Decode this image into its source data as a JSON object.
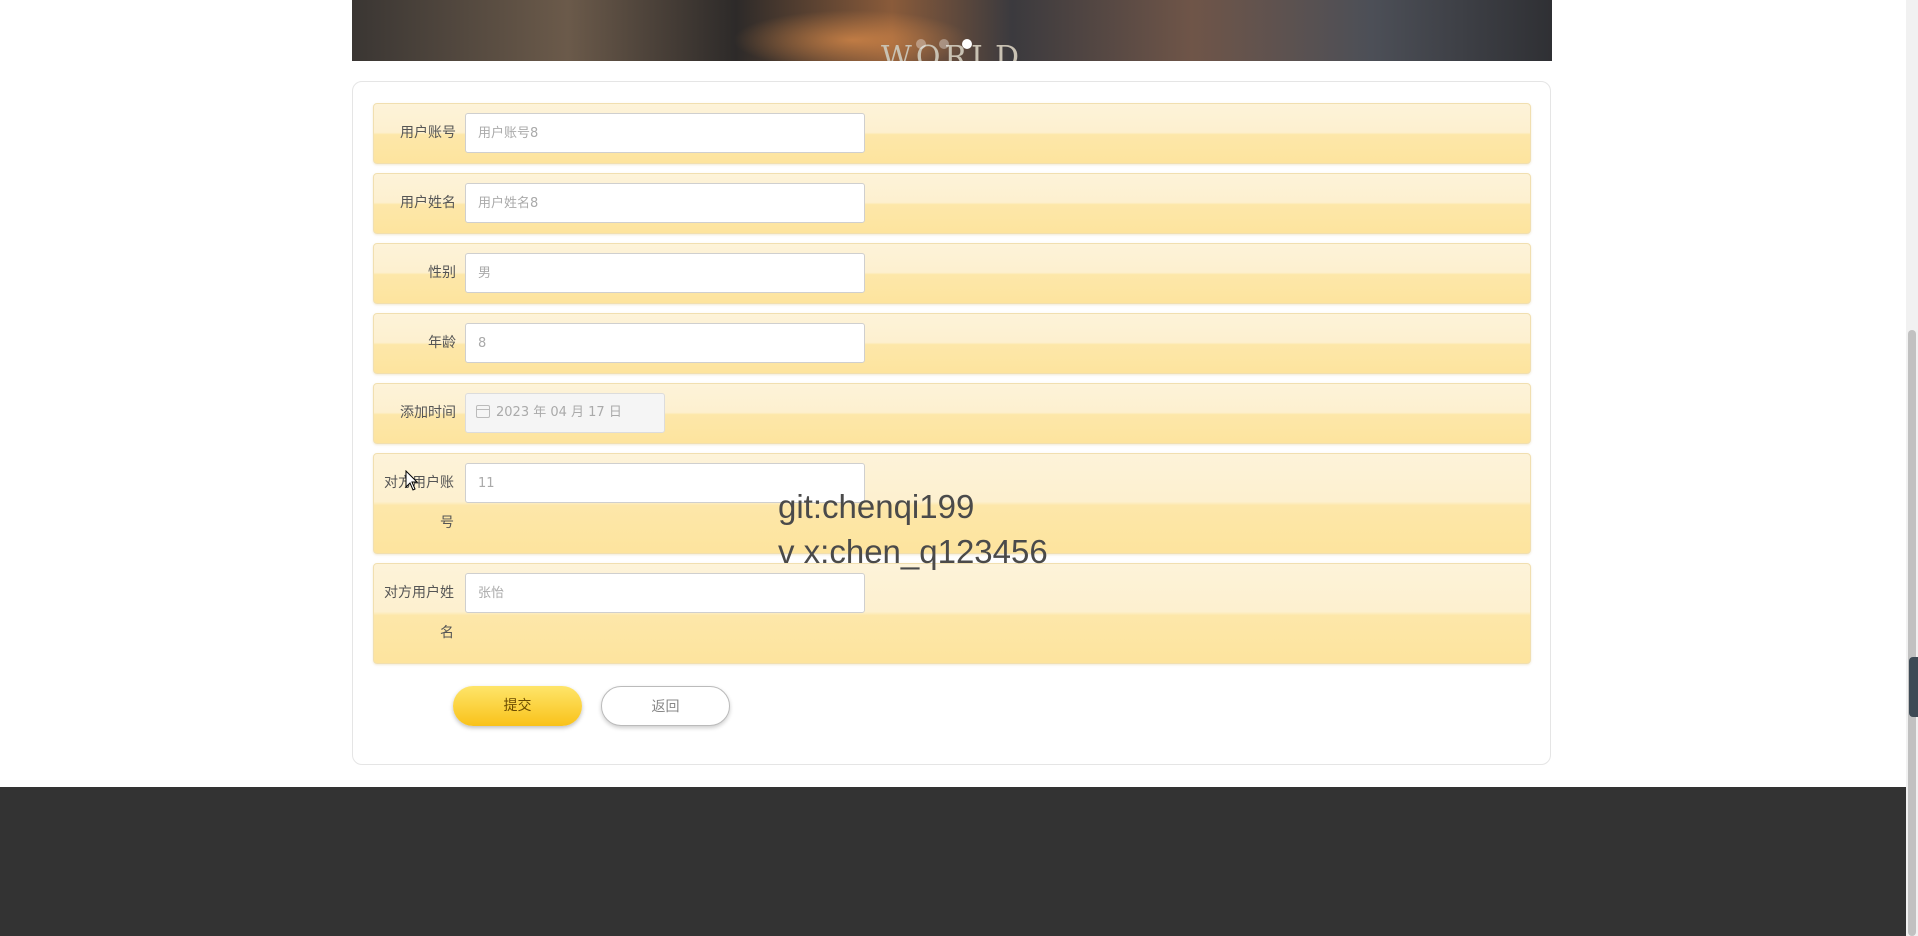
{
  "form": {
    "fields": [
      {
        "label": "用户账号",
        "placeholder": "用户账号8"
      },
      {
        "label": "用户姓名",
        "placeholder": "用户姓名8"
      },
      {
        "label": "性别",
        "placeholder": "男"
      },
      {
        "label": "年龄",
        "placeholder": "8"
      },
      {
        "label": "添加时间",
        "value": "2023 年 04 月 17 日"
      },
      {
        "label": "对方用户账号",
        "placeholder": "11"
      },
      {
        "label": "对方用户姓名",
        "placeholder": "张怡"
      }
    ],
    "submit_label": "提交",
    "back_label": "返回"
  },
  "watermark": {
    "line1": "git:chenqi199",
    "line2": "v x:chen_q123456"
  },
  "banner": {
    "logo_text": "WORLD"
  },
  "colors": {
    "row_bg": "#fde7a9",
    "submit_bg": "#f9c21a",
    "footer_bg": "#333333"
  }
}
